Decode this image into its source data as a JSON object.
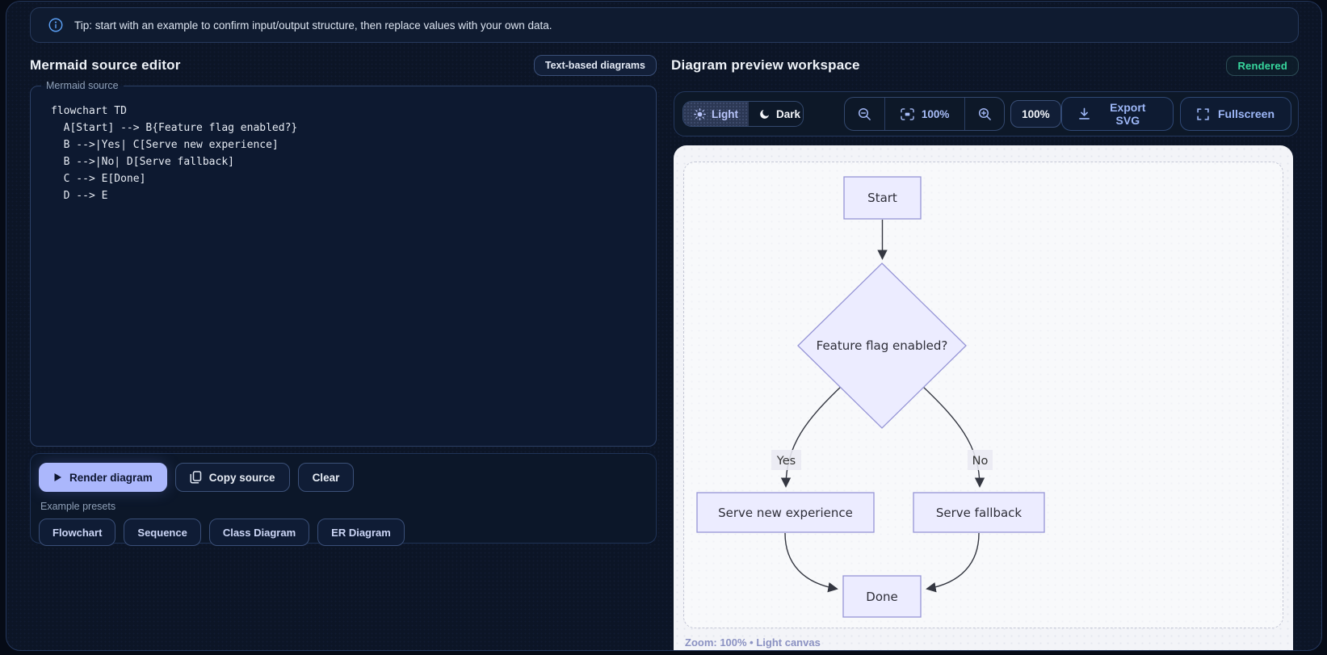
{
  "tip": {
    "text": "Tip: start with an example to confirm input/output structure, then replace values with your own data."
  },
  "editor_panel": {
    "title": "Mermaid source editor",
    "badge": "Text-based diagrams",
    "field_label": "Mermaid source",
    "code_lines": [
      "flowchart TD",
      "  A[Start] --> B{Feature flag enabled?}",
      "  B -->|Yes| C[Serve new experience]",
      "  B -->|No| D[Serve fallback]",
      "  C --> E[Done]",
      "  D --> E"
    ],
    "actions": {
      "render": "Render diagram",
      "copy": "Copy source",
      "clear": "Clear"
    },
    "presets_label": "Example presets",
    "presets": [
      "Flowchart",
      "Sequence",
      "Class Diagram",
      "ER Diagram"
    ]
  },
  "preview_panel": {
    "title": "Diagram preview workspace",
    "status_badge": "Rendered",
    "toolbar": {
      "light": "Light",
      "dark": "Dark",
      "fit_zoom": "100%",
      "zoom_chip": "100%",
      "export": "Export SVG",
      "fullscreen": "Fullscreen"
    },
    "statusbar": "Zoom: 100% • Light canvas"
  },
  "diagram": {
    "type": "flowchart",
    "direction": "TD",
    "nodes": {
      "start": "Start",
      "decision": "Feature flag enabled?",
      "yes_branch": "Serve new experience",
      "no_branch": "Serve fallback",
      "done": "Done"
    },
    "edge_labels": {
      "yes": "Yes",
      "no": "No"
    }
  },
  "colors": {
    "accent": "#abb7fc",
    "rendered_green": "#37d89e",
    "node_fill": "#ECECFF",
    "node_stroke": "#9695d6",
    "canvas_bg": "#f3f4f8",
    "panel_bg": "#0c1526"
  }
}
